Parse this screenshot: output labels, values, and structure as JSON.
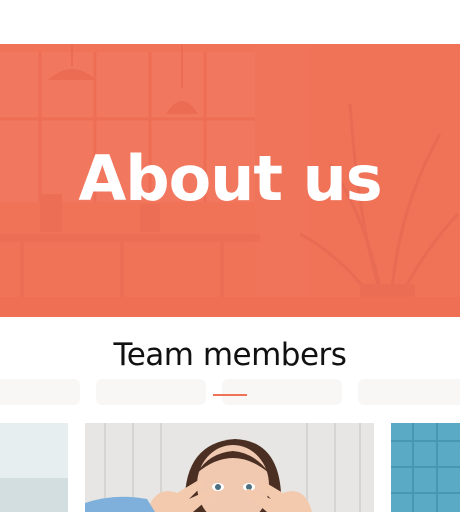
{
  "hero": {
    "title": "About us",
    "background_description_icon": "office-photo",
    "overlay_color": "#ef7056"
  },
  "team": {
    "section_title": "Team members",
    "accent_color": "#ef7156",
    "members": [
      {
        "photo_icon": "team-member-photo"
      },
      {
        "photo_icon": "team-member-photo"
      },
      {
        "photo_icon": "team-member-photo"
      }
    ]
  }
}
